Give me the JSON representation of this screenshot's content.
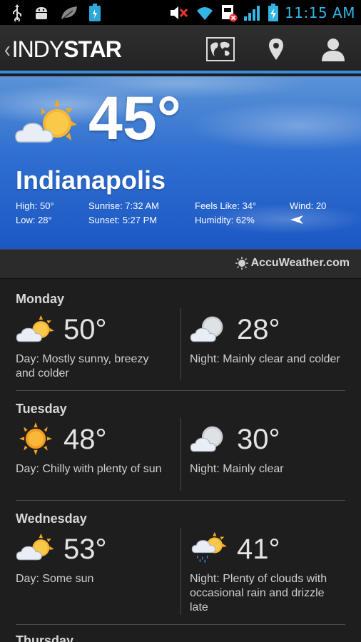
{
  "status_bar": {
    "time": "11:15 AM",
    "icons": [
      "usb-icon",
      "android-debug-icon",
      "leaf-icon",
      "battery-app-icon",
      "mute-icon",
      "wifi-icon",
      "sim-error-icon",
      "signal-icon",
      "battery-charging-icon"
    ]
  },
  "app_bar": {
    "brand_prefix": "INDY",
    "brand_suffix": "STAR",
    "actions": [
      "map-icon",
      "location-pin-icon",
      "profile-icon"
    ]
  },
  "current": {
    "temperature": "45°",
    "city": "Indianapolis",
    "condition_icon": "partly-cloudy-icon",
    "high": "High: 50°",
    "low": "Low: 28°",
    "sunrise": "Sunrise: 7:32 AM",
    "sunset": "Sunset: 5:27 PM",
    "feels_like": "Feels Like: 34°",
    "humidity": "Humidity: 62%",
    "wind": "Wind: 20",
    "wind_direction_icon": "wind-arrow-icon"
  },
  "provider": "AccuWeather.com",
  "forecast": [
    {
      "day": "Monday",
      "day_temp": "50°",
      "day_icon": "partly-sunny-icon",
      "day_desc": "Day: Mostly sunny, breezy and colder",
      "night_temp": "28°",
      "night_icon": "moon-cloud-icon",
      "night_desc": "Night: Mainly clear and colder"
    },
    {
      "day": "Tuesday",
      "day_temp": "48°",
      "day_icon": "sunny-icon",
      "day_desc": "Day: Chilly with plenty of sun",
      "night_temp": "30°",
      "night_icon": "moon-cloud-icon",
      "night_desc": "Night: Mainly clear"
    },
    {
      "day": "Wednesday",
      "day_temp": "53°",
      "day_icon": "partly-sunny-icon",
      "day_desc": "Day: Some sun",
      "night_temp": "41°",
      "night_icon": "rain-icon",
      "night_desc": "Night: Plenty of clouds with occasional rain and drizzle late"
    },
    {
      "day": "Thursday"
    }
  ]
}
